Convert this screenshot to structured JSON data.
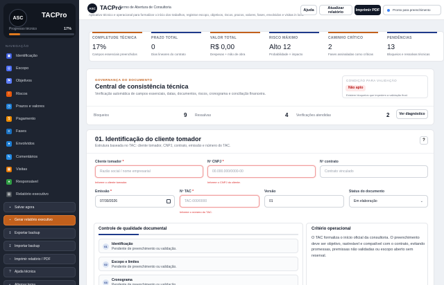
{
  "app": {
    "logo_text": "ASC",
    "name": "TACPro",
    "progress_label": "Progresso técnico",
    "progress_value": "17%",
    "progress_fraction": 0.17,
    "accent_color": "#c2601c"
  },
  "sidebar": {
    "section_label": "NAVEGAÇÃO",
    "items": [
      {
        "label": "Identificação",
        "icon": "id-card-icon",
        "color": "#3b5bdb",
        "glyph": "▣"
      },
      {
        "label": "Escopo",
        "icon": "target-icon",
        "color": "#4c6ef5",
        "glyph": "◎"
      },
      {
        "label": "Objetivos",
        "icon": "flag-icon",
        "color": "#5c7cfa",
        "glyph": "⚑"
      },
      {
        "label": "Riscos",
        "icon": "warning-icon",
        "color": "#e8590c",
        "glyph": "!"
      },
      {
        "label": "Prazos e valores",
        "icon": "clock-icon",
        "color": "#1c7ed6",
        "glyph": "◷"
      },
      {
        "label": "Pagamento",
        "icon": "payment-icon",
        "color": "#f08c00",
        "glyph": "$"
      },
      {
        "label": "Fases",
        "icon": "layers-icon",
        "color": "#1971c2",
        "glyph": "≡"
      },
      {
        "label": "Envolvidos",
        "icon": "users-icon",
        "color": "#1c7ed6",
        "glyph": "●"
      },
      {
        "label": "Comentários",
        "icon": "comment-icon",
        "color": "#228be6",
        "glyph": "✎"
      },
      {
        "label": "Visitas",
        "icon": "calendar-icon",
        "color": "#e67700",
        "glyph": "▦"
      },
      {
        "label": "Responsável",
        "icon": "person-icon",
        "color": "#2f9e44",
        "glyph": "♦"
      },
      {
        "label": "Relatório executivo",
        "icon": "report-icon",
        "color": "#495057",
        "glyph": "▤"
      }
    ],
    "actions": [
      {
        "label": "Salvar agora",
        "icon": "save-icon",
        "glyph": "▪",
        "primary": false
      },
      {
        "label": "Gerar relatório executivo",
        "icon": "document-icon",
        "glyph": "▪",
        "primary": true
      },
      {
        "label": "Exportar backup",
        "icon": "export-icon",
        "glyph": "↥",
        "primary": false
      },
      {
        "label": "Importar backup",
        "icon": "import-icon",
        "glyph": "↧",
        "primary": false
      },
      {
        "label": "Imprimir relatório / PDF",
        "icon": "print-icon",
        "glyph": "▫",
        "primary": false
      },
      {
        "label": "Ajuda técnica",
        "icon": "help-icon",
        "glyph": "?",
        "primary": false
      },
      {
        "label": "Alternar tema",
        "icon": "theme-icon",
        "glyph": "◐",
        "primary": false
      }
    ]
  },
  "header": {
    "logo_text": "ASC",
    "title": "TACPro",
    "subtitle": "Termo de Abertura de Consultoria",
    "description": "Aplicativo técnico e operacional para formalizar o início dos trabalhos, registrar escopo, objetivos, riscos, prazos, valores, fases, envolvidos e visitas in loco.",
    "help_button": "Ajuda",
    "update_button": "Atualizar relatório",
    "print_button": "Imprimir PDF",
    "status_text": "Pronto para preenchimento"
  },
  "summary": [
    {
      "label": "COMPLETUDE TÉCNICA",
      "value": "17%",
      "hint": "Campos essenciais preenchidos",
      "bar": "orange"
    },
    {
      "label": "PRAZO TOTAL",
      "value": "0",
      "hint": "Dias lineares do contrato",
      "bar": "blue"
    },
    {
      "label": "VALOR TOTAL",
      "value": "R$ 0,00",
      "hint": "Despesas + mão de obra",
      "bar": "orange"
    },
    {
      "label": "RISCO MÁXIMO",
      "value": "Alto 12",
      "hint": "Probabilidade × impacto",
      "bar": "blue"
    },
    {
      "label": "CAMINHO CRÍTICO",
      "value": "2",
      "hint": "Fases assinaladas como críticas",
      "bar": "orange"
    },
    {
      "label": "PENDÊNCIAS",
      "value": "13",
      "hint": "Bloqueios e ressalvas técnicas",
      "bar": "blue"
    }
  ],
  "consistency": {
    "eyebrow": "GOVERNANÇA DO DOCUMENTO",
    "title": "Central de consistência técnica",
    "description": "Verificação automática de campos essenciais, datas, documentos, riscos, cronograma e conciliação financeira.",
    "validation_label": "CONDIÇÃO PARA VALIDAÇÃO",
    "validation_badge": "Não apto",
    "validation_note": "Existem bloqueios que impedem a validação final.",
    "stats": [
      {
        "label": "Bloqueios",
        "value": "9"
      },
      {
        "label": "Ressalvas",
        "value": "4"
      },
      {
        "label": "Verificações atendidas",
        "value": "2"
      }
    ],
    "diagnostic_button": "Ver diagnóstico"
  },
  "section": {
    "title": "01. Identificação do cliente tomador",
    "description": "Estrutura baseada no TAC: cliente tomador, CNPJ, contrato, emissão e número do TAC.",
    "help_label": "?",
    "fields": {
      "client": {
        "label": "Cliente tomador",
        "required": "*",
        "placeholder": "Razão social / nome empresarial",
        "error": "Informe o cliente tomador."
      },
      "cnpj": {
        "label": "Nº CNPJ",
        "required": "*",
        "placeholder": "00.000.000/0000-00",
        "error": "Informe o CNPJ do cliente."
      },
      "contract": {
        "label": "Nº contrato",
        "placeholder": "Contrato vinculado"
      },
      "emission": {
        "label": "Emissão",
        "required": "*",
        "value": "07/30/2026"
      },
      "tac": {
        "label": "Nº TAC",
        "required": "*",
        "placeholder": "TAC-000/0000",
        "error": "Informe o número do TAC."
      },
      "version": {
        "label": "Versão",
        "value": "01"
      },
      "status": {
        "label": "Status do documento",
        "value": "Em elaboração"
      }
    },
    "quality": {
      "title": "Controle de qualidade documental",
      "progress_fraction": 0.2,
      "items": [
        {
          "num": "01",
          "name": "Identificação",
          "status": "Pendente de preenchimento ou validação."
        },
        {
          "num": "02",
          "name": "Escopo e limites",
          "status": "Pendente de preenchimento ou validação."
        },
        {
          "num": "03",
          "name": "Cronograma",
          "status": "Pendente de preenchimento ou validação."
        }
      ]
    },
    "criterion": {
      "title": "Critério operacional",
      "text": "O TAC formaliza o início oficial da consultoria. O preenchimento deve ser objetivo, rastreável e compatível com o contrato, evitando promessas, premissas não validadas ou escopo aberto sem reserval."
    }
  }
}
